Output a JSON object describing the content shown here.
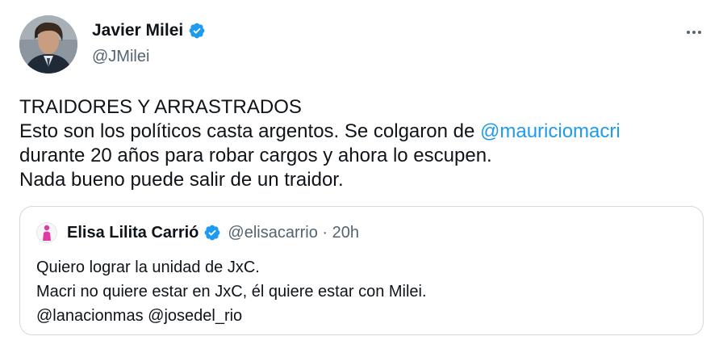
{
  "tweet": {
    "author": {
      "name": "Javier Milei",
      "handle": "@JMilei",
      "verified_icon": "verified-badge-icon",
      "avatar_icon": "profile-photo"
    },
    "more_icon": "more-options-icon",
    "text": {
      "line1": "TRAIDORES Y ARRASTRADOS",
      "line2_before": "Esto son los políticos casta argentos. Se colgaron de ",
      "line2_mention": "@mauriciomacri",
      "line3": "durante 20 años para robar cargos y ahora lo escupen.",
      "line4": "Nada bueno puede salir de un traidor."
    },
    "quoted": {
      "author_name": "Elisa Lilita Carrió",
      "handle_time": "@elisacarrio · 20h",
      "avatar_icon": "pink-figure-icon",
      "text": {
        "line1": "Quiero lograr la unidad de JxC.",
        "line2": "Macri no quiere estar en JxC, él quiere estar con Milei.",
        "line3": "@lanacionmas @josedel_rio"
      }
    }
  },
  "colors": {
    "text": "#0f1419",
    "secondary": "#536471",
    "link": "#1d9bf0",
    "border": "#cfd9de",
    "verified": "#1d9bf0"
  }
}
